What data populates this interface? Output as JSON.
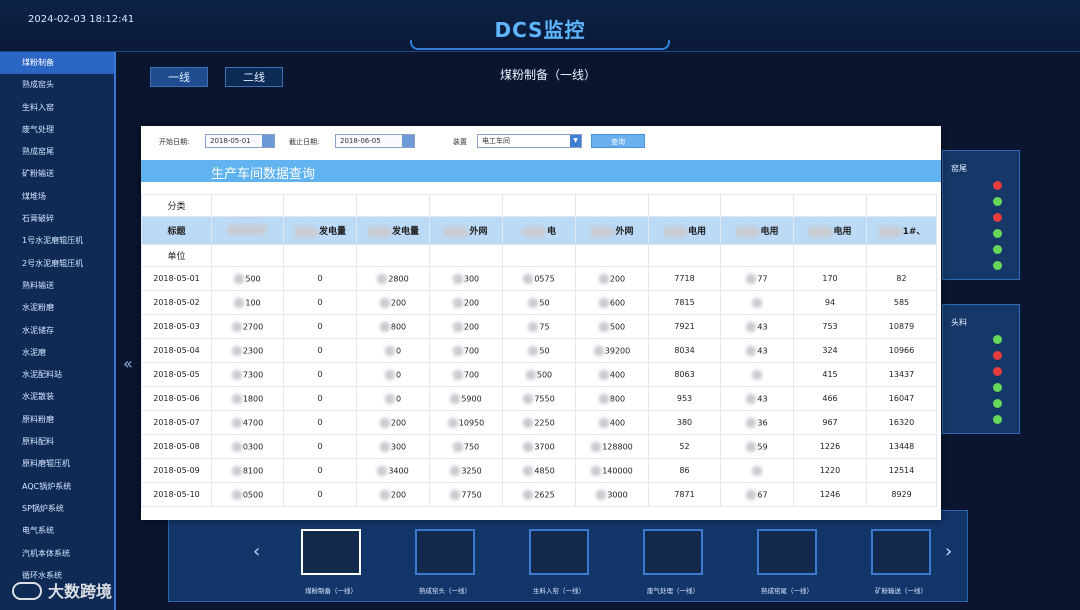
{
  "header": {
    "timestamp": "2024-02-03 18:12:41",
    "title": "DCS监控"
  },
  "sidebar": {
    "items": [
      {
        "label": "煤粉制备",
        "active": true
      },
      {
        "label": "熟成窑头"
      },
      {
        "label": "生料入窑"
      },
      {
        "label": "废气处理"
      },
      {
        "label": "熟成窑尾"
      },
      {
        "label": "矿粉输送"
      },
      {
        "label": "煤堆场"
      },
      {
        "label": "石膏破碎"
      },
      {
        "label": "1号水泥磨辊压机"
      },
      {
        "label": "2号水泥磨辊压机"
      },
      {
        "label": "熟料输送"
      },
      {
        "label": "水泥粉磨"
      },
      {
        "label": "水泥储存"
      },
      {
        "label": "水泥磨"
      },
      {
        "label": "水泥配料站"
      },
      {
        "label": "水泥散装"
      },
      {
        "label": "原料粉磨"
      },
      {
        "label": "原料配料"
      },
      {
        "label": "原料磨辊压机"
      },
      {
        "label": "AQC锅炉系统"
      },
      {
        "label": "SP锅炉系统"
      },
      {
        "label": "电气系统"
      },
      {
        "label": "汽机本体系统"
      },
      {
        "label": "循环水系统"
      }
    ]
  },
  "line_tabs": [
    "一线",
    "二线"
  ],
  "page_title": "煤粉制备（一线）",
  "collapse_icon": "«",
  "status_panels": [
    {
      "label": "窑尾",
      "dots": [
        "red",
        "green",
        "red",
        "green",
        "green",
        "green"
      ]
    },
    {
      "label": "头料",
      "dots": [
        "green",
        "red",
        "red",
        "green",
        "green",
        "green"
      ]
    }
  ],
  "query": {
    "start_label": "开始日期:",
    "start_value": "2018-05-01",
    "end_label": "截止日期:",
    "end_value": "2018-06-05",
    "device_label": "装置",
    "device_value": "电工车间",
    "search_button": "查询",
    "banner_title": "生产车间数据查询"
  },
  "table": {
    "row_labels": {
      "category": "分类",
      "title": "标题",
      "unit": "单位"
    },
    "headers": [
      "发电量",
      "发电量",
      "外网",
      "电",
      "外网",
      "电用",
      "电用",
      "电用",
      "1#、"
    ],
    "rows": [
      {
        "date": "2018-05-01",
        "cells": [
          "500",
          "0",
          "2800",
          "300",
          "0575",
          "200",
          "7718",
          "77",
          "170",
          "82"
        ]
      },
      {
        "date": "2018-05-02",
        "cells": [
          "100",
          "0",
          "200",
          "200",
          "50",
          "600",
          "7815",
          "",
          "94",
          "585"
        ]
      },
      {
        "date": "2018-05-03",
        "cells": [
          "2700",
          "0",
          "800",
          "200",
          "75",
          "500",
          "7921",
          "43",
          "753",
          "10879"
        ]
      },
      {
        "date": "2018-05-04",
        "cells": [
          "2300",
          "0",
          "0",
          "700",
          "50",
          "39200",
          "8034",
          "43",
          "324",
          "10966"
        ]
      },
      {
        "date": "2018-05-05",
        "cells": [
          "7300",
          "0",
          "0",
          "700",
          "500",
          "400",
          "8063",
          "",
          "415",
          "13437"
        ]
      },
      {
        "date": "2018-05-06",
        "cells": [
          "1800",
          "0",
          "0",
          "5900",
          "7550",
          "800",
          "953",
          "43",
          "466",
          "16047"
        ]
      },
      {
        "date": "2018-05-07",
        "cells": [
          "4700",
          "0",
          "200",
          "10950",
          "2250",
          "400",
          "380",
          "36",
          "967",
          "16320"
        ]
      },
      {
        "date": "2018-05-08",
        "cells": [
          "0300",
          "0",
          "300",
          "750",
          "3700",
          "128800",
          "52",
          "59",
          "1226",
          "13448"
        ]
      },
      {
        "date": "2018-05-09",
        "cells": [
          "8100",
          "0",
          "3400",
          "3250",
          "4850",
          "140000",
          "86",
          "",
          "1220",
          "12514"
        ]
      },
      {
        "date": "2018-05-10",
        "cells": [
          "0500",
          "0",
          "200",
          "7750",
          "2625",
          "3000",
          "7871",
          "67",
          "1246",
          "8929"
        ]
      }
    ]
  },
  "thumbnails": [
    {
      "label": "煤粉制备（一线）",
      "selected": true
    },
    {
      "label": "熟成窑头（一线）"
    },
    {
      "label": "生料入窑（一线）"
    },
    {
      "label": "废气处理（一线）"
    },
    {
      "label": "熟成窑尾（一线）"
    },
    {
      "label": "矿粉输送（一线）"
    }
  ],
  "nav": {
    "prev": "‹",
    "next": "›"
  },
  "watermark": "大数跨境"
}
